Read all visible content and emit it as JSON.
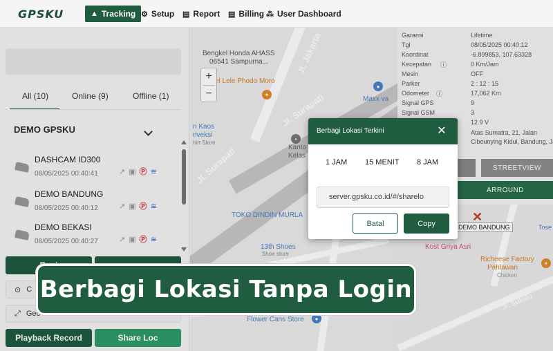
{
  "navbar": {
    "logo": "GPSKU",
    "items": [
      {
        "label": "Tracking",
        "icon": "navigation-arrow-icon",
        "active": true
      },
      {
        "label": "Setup",
        "icon": "gear-icon"
      },
      {
        "label": "Report",
        "icon": "document-icon"
      },
      {
        "label": "Billing",
        "icon": "document-icon"
      },
      {
        "label": "User Dashboard",
        "icon": "users-icon"
      }
    ]
  },
  "left_panel": {
    "tabs": [
      {
        "label": "All (10)",
        "active": true
      },
      {
        "label": "Online (9)"
      },
      {
        "label": "Offline (1)"
      }
    ],
    "group_title": "DEMO GPSKU",
    "vehicles": [
      {
        "name": "DASHCAM ID300",
        "time": "08/05/2025 00:40:41"
      },
      {
        "name": "DEMO BANDUNG",
        "time": "08/05/2025 00:40:12"
      },
      {
        "name": "DEMO BEKASI",
        "time": "08/05/2025 00:40:27"
      }
    ],
    "buttons": {
      "engine_partial": "Engi",
      "playback": "Playback Record",
      "share_loc": "Share Loc",
      "center_partial": "C",
      "geofence_partial": "Geo"
    }
  },
  "map": {
    "roads": [
      "Jl. Jakarta",
      "Jl. Surapati",
      "Jl. Surapati"
    ],
    "pois": [
      "Bengkel Honda AHASS",
      "06541 Sampurna...",
      "el Lele Phodo Moro",
      "Maxx va",
      "n Kaos",
      "nveksi",
      "hirt Store",
      "Kanto",
      "Kelas",
      "TOKO DINDIN MURLA",
      "13th Shoes",
      "Shoe store",
      "Flower Cans Store"
    ],
    "zoom_in": "+",
    "zoom_out": "−"
  },
  "right_panel": {
    "info": [
      {
        "key": "Garansi",
        "value": "Lifetime"
      },
      {
        "key": "Tgl",
        "value": "08/05/2025 00:40:12"
      },
      {
        "key": "Koordinat",
        "value": "-6.899853, 107.63328"
      },
      {
        "key": "Kecepatan",
        "value": "0 Km/Jam"
      },
      {
        "key": "Mesin",
        "value": "OFF"
      },
      {
        "key": "Parker",
        "value": "2 : 12 : 15"
      },
      {
        "key": "Odometer",
        "value": "17,062 Km"
      },
      {
        "key": "Signal GPS",
        "value": "9"
      },
      {
        "key": "Signal GSM",
        "value": "3"
      }
    ],
    "voltage": "12.9 V",
    "address": [
      "Atas Sumatra, 21, Jalan",
      "Cibeunying Kidul, Bandung, Jabar"
    ],
    "streetview": "STREETVIEW",
    "around": "ARROUND",
    "mini_map_labels": [
      "DEMO BANDUNG",
      "Tose",
      "Kost Griya Asri",
      "Richeese Factory",
      "Pahlawan",
      "Chicken",
      "Jl. Sukalu"
    ]
  },
  "modal": {
    "title": "Berbagi Lokasi Terkini",
    "durations": [
      "1 JAM",
      "15 MENIT",
      "8 JAM"
    ],
    "share_url": "server.gpsku.co.id/#/sharelo",
    "batal": "Batal",
    "copy": "Copy"
  },
  "banner": {
    "text": "Berbagi Lokasi Tanpa Login"
  },
  "colors": {
    "primary": "#1f5c40",
    "accent_red": "#d83a3a",
    "accent_blue": "#2f73d6"
  }
}
